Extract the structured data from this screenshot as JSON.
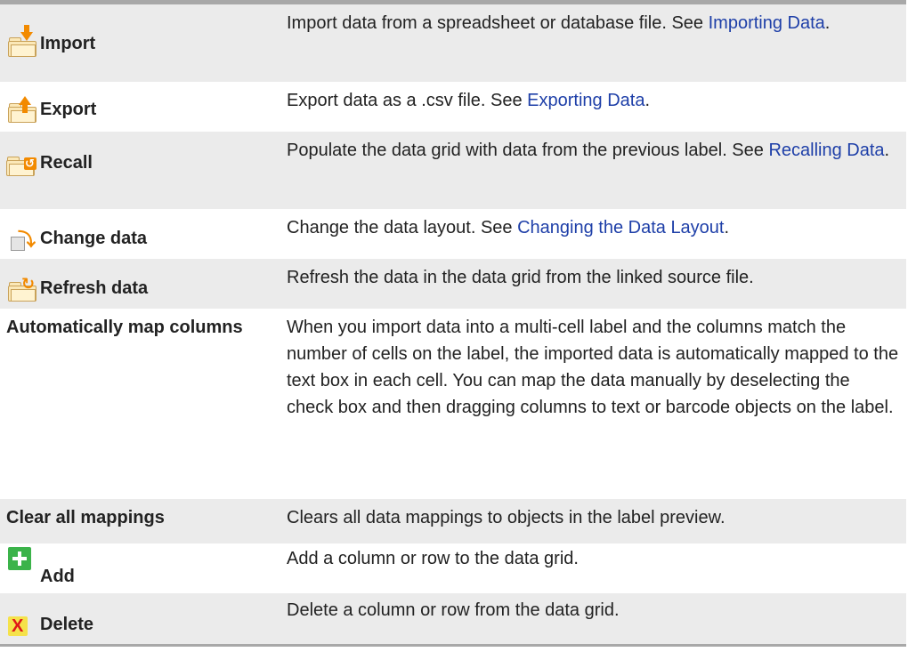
{
  "rows": [
    {
      "name": "Import",
      "icon": "import-icon",
      "desc_before": "Import data from a spreadsheet or database file. See ",
      "link": "Importing Data",
      "desc_after": "."
    },
    {
      "name": "Export",
      "icon": "export-icon",
      "desc_before": "Export data as a .csv file. See ",
      "link": "Exporting Data",
      "desc_after": "."
    },
    {
      "name": "Recall",
      "icon": "recall-icon",
      "desc_before": "Populate the data grid with data from the previous label. See ",
      "link": "Recalling Data",
      "desc_after": "."
    },
    {
      "name": "Change data",
      "icon": "change-data-icon",
      "desc_before": "Change the data layout. See ",
      "link": "Changing the Data Layout",
      "desc_after": "."
    },
    {
      "name": "Refresh data",
      "icon": "refresh-data-icon",
      "desc_before": "Refresh the data in the data grid from the linked source file.",
      "link": "",
      "desc_after": ""
    },
    {
      "name": "Automatically map columns",
      "icon": "",
      "desc_before": "When you import data into a multi-cell label and the columns match the number of cells on the label, the imported data is automatically mapped to the text box in each cell. You can map the data manually by deselecting the check box and then dragging columns to text or barcode objects on the label.",
      "link": "",
      "desc_after": ""
    },
    {
      "name": "Clear all mappings",
      "icon": "",
      "desc_before": "Clears all data mappings to objects in the label preview.",
      "link": "",
      "desc_after": ""
    },
    {
      "name": "Add",
      "icon": "add-icon",
      "desc_before": "Add a column or row to the data grid.",
      "link": "",
      "desc_after": ""
    },
    {
      "name": "Delete",
      "icon": "delete-icon",
      "desc_before": "Delete a column or row from the data grid.",
      "link": "",
      "desc_after": ""
    }
  ]
}
